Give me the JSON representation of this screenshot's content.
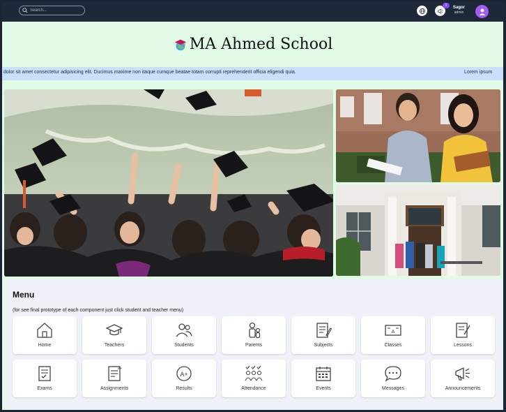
{
  "topbar": {
    "search_placeholder": "Search...",
    "notification_count": "1",
    "user_name": "Sagor",
    "user_role": "admin"
  },
  "header": {
    "school_name": "MA Ahmed School"
  },
  "ticker": {
    "text_main": "dolor sit amet consectetur adipisicing elit. Ducimus maxime non itaque cumque beatae totam corrupti reprehenderit officia eligendi quia.",
    "text_tail": "Lorem ipsum"
  },
  "menu": {
    "title": "Menu",
    "note": "(for see final prototype of each component just click student and teacher menu)",
    "items": [
      {
        "label": "Home",
        "icon": "home-icon"
      },
      {
        "label": "Teachers",
        "icon": "graduation-cap-icon"
      },
      {
        "label": "Students",
        "icon": "users-icon"
      },
      {
        "label": "Parents",
        "icon": "parents-icon"
      },
      {
        "label": "Subjects",
        "icon": "subjects-icon"
      },
      {
        "label": "Classes",
        "icon": "classes-icon"
      },
      {
        "label": "Lessons",
        "icon": "lessons-icon"
      },
      {
        "label": "Exams",
        "icon": "exams-icon"
      },
      {
        "label": "Assignments",
        "icon": "assignments-icon"
      },
      {
        "label": "Results",
        "icon": "results-icon"
      },
      {
        "label": "Attendance",
        "icon": "attendance-icon"
      },
      {
        "label": "Events",
        "icon": "events-icon"
      },
      {
        "label": "Messages",
        "icon": "messages-icon"
      },
      {
        "label": "Announcements",
        "icon": "announcements-icon"
      }
    ]
  },
  "colors": {
    "topbar": "#1e2838",
    "content_bg": "#e1fbe7",
    "ticker_bg": "#c8e0fb",
    "menu_bg": "#eef1f7",
    "avatar": "#a15cf0"
  }
}
